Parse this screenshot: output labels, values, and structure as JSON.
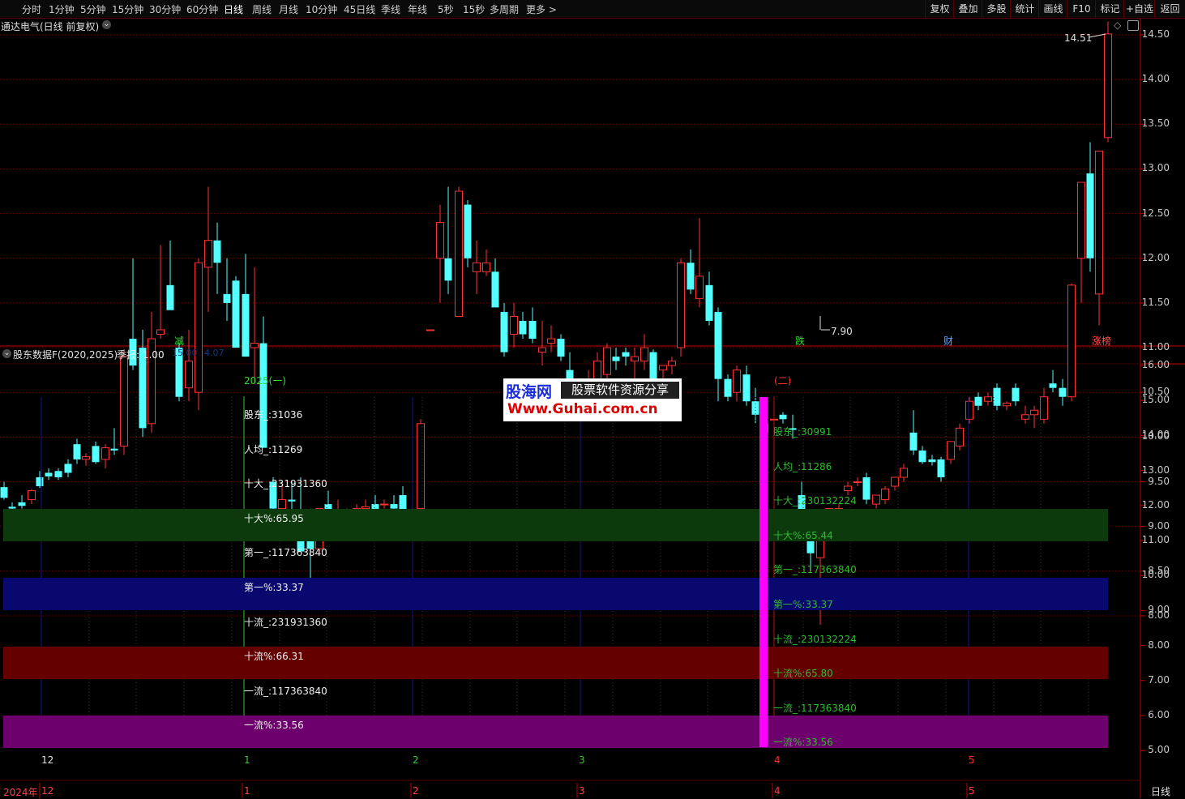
{
  "toolbar": {
    "periods": [
      "分时",
      "1分钟",
      "5分钟",
      "15分钟",
      "30分钟",
      "60分钟",
      "日线",
      "周线",
      "月线",
      "10分钟",
      "45日线",
      "季线",
      "年线",
      "5秒",
      "15秒",
      "多周期",
      "更多 >"
    ],
    "active_period": "日线",
    "right_buttons": [
      "复权",
      "叠加",
      "多股",
      "统计",
      "画线",
      "F10",
      "标记",
      "+自选",
      "返回"
    ]
  },
  "main_chart": {
    "title": "通达电气(日线 前复权)",
    "chevron_icon": "chevron-down-icon",
    "high_label": "14.51",
    "low_label": "7.90",
    "y_ticks": [
      "14.50",
      "14.00",
      "13.50",
      "13.00",
      "12.50",
      "12.00",
      "11.50",
      "11.00",
      "10.50",
      "10.00",
      "9.50",
      "9.00",
      "8.50",
      "8.00"
    ],
    "event_tags": [
      {
        "label": "减",
        "color": "#34d834"
      },
      {
        "label": "跌",
        "color": "#34d834"
      },
      {
        "label": "财",
        "color": "#5aa8ff"
      },
      {
        "label": "涨榜",
        "color": "#ff5050"
      }
    ],
    "colors": {
      "up": "#ff3232",
      "down": "#54ffff",
      "grid": "#7a0000"
    }
  },
  "indicator": {
    "title": "股东数据F(2020,2025)",
    "param": "季报: 1.00",
    "faint_values": [
      "15.00",
      "4.07"
    ],
    "y_ticks": [
      "16.00",
      "15.00",
      "14.00",
      "13.00",
      "12.00",
      "11.00",
      "10.00",
      "9.00",
      "8.00",
      "7.00",
      "6.00",
      "5.00"
    ],
    "left_header": "2025(一)",
    "right_header": "(二)",
    "left_values": [
      "股东_:31036",
      "人均_:11269",
      "十大_:231931360",
      "十大%:65.95",
      "第一_:117363840",
      "第一%:33.37",
      "十流_:231931360",
      "十流%:66.31",
      "一流_:117363840",
      "一流%:33.56"
    ],
    "right_values": [
      "股东_:30991",
      "人均_:11286",
      "十大_:230132224",
      "十大%:65.44",
      "第一_:117363840",
      "第一%:33.37",
      "十流_:230132224",
      "十流%:65.80",
      "一流_:117363840",
      "一流%:33.56"
    ],
    "band_colors": [
      "#0c3a0c",
      "#08086e",
      "#640000",
      "#6e006e"
    ],
    "highlight_color": "#ff00ff",
    "month_labels": [
      "12",
      "1",
      "2",
      "3",
      "4",
      "5"
    ]
  },
  "watermark": {
    "line1": "股海网",
    "line2": "股票软件资源分享",
    "line3": "Www.Guhai.com.cn"
  },
  "timeline": {
    "year_label": "2024年",
    "months": [
      "12",
      "1",
      "2",
      "3",
      "4",
      "5"
    ]
  },
  "status": {
    "period": "日线"
  }
}
